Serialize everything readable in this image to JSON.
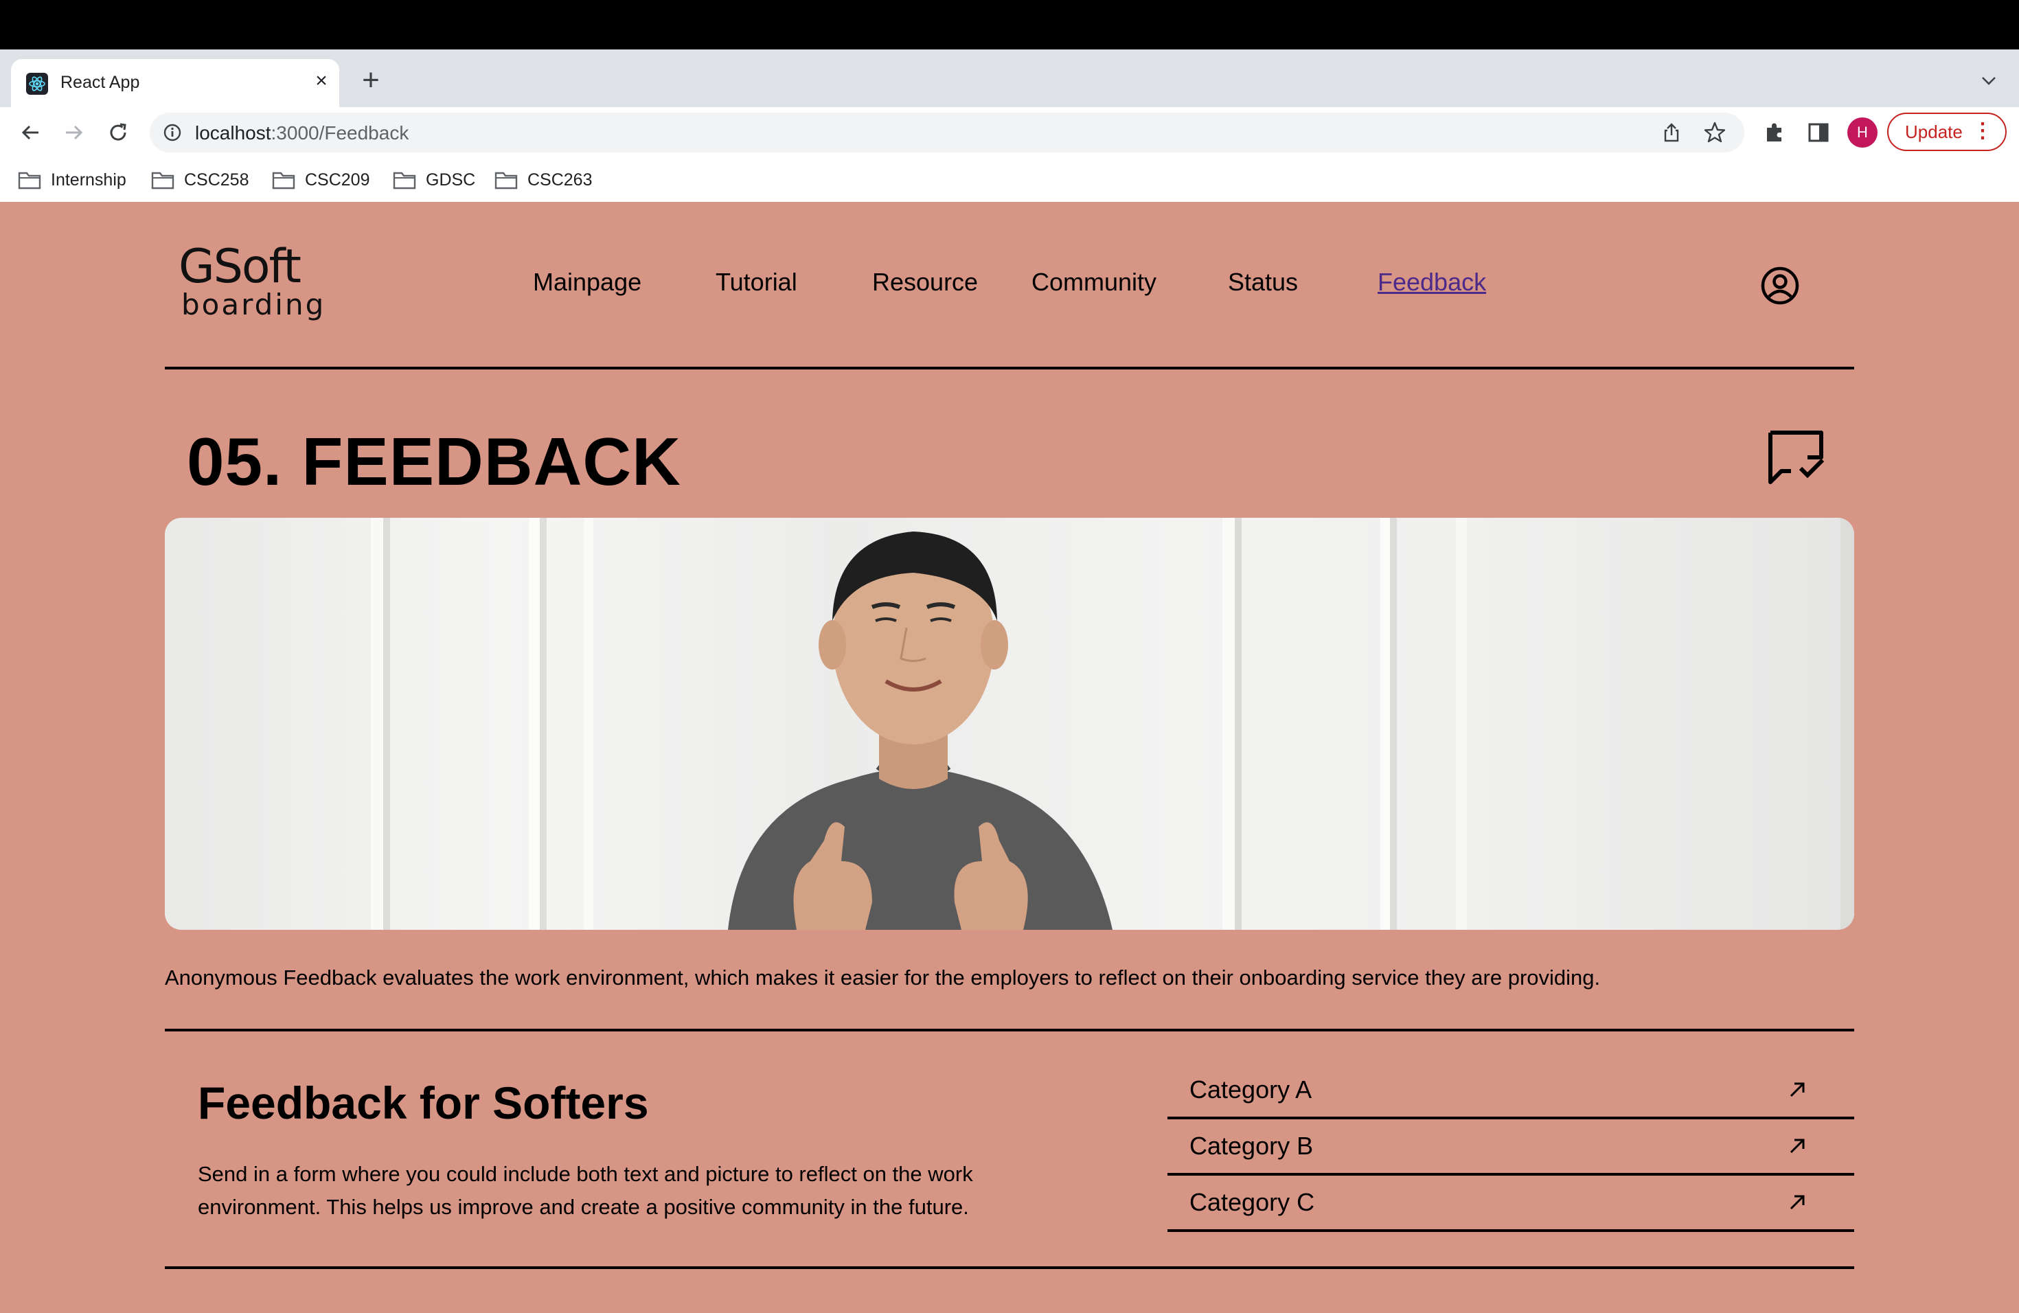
{
  "browser": {
    "tab_title": "React App",
    "url_host": "localhost",
    "url_path": ":3000/Feedback",
    "profile_initial": "H",
    "update_label": "Update",
    "bookmarks": [
      "Internship",
      "CSC258",
      "CSC209",
      "GDSC",
      "CSC263"
    ]
  },
  "header": {
    "logo_top": "GSoft",
    "logo_bottom": "boarding",
    "nav": [
      "Mainpage",
      "Tutorial",
      "Resource",
      "Community",
      "Status",
      "Feedback"
    ],
    "active_nav": "Feedback"
  },
  "main": {
    "title": "05. FEEDBACK",
    "description": "Anonymous Feedback evaluates the work environment, which makes it easier for the employers to reflect on their onboarding service they are providing.",
    "section": {
      "title": "Feedback for Softers",
      "text": "Send in a form where you could include both text and picture to reflect on the work environment. This helps us improve and create a positive community in the future."
    },
    "categories": [
      "Category A",
      "Category B",
      "Category C"
    ]
  },
  "colors": {
    "page_background": "#d79585",
    "active_link": "#4b2a8a",
    "profile": "#c2185b"
  },
  "icons": {
    "user": "user-circle-icon",
    "feedback": "message-check-icon",
    "category": "arrow-up-right-icon"
  }
}
